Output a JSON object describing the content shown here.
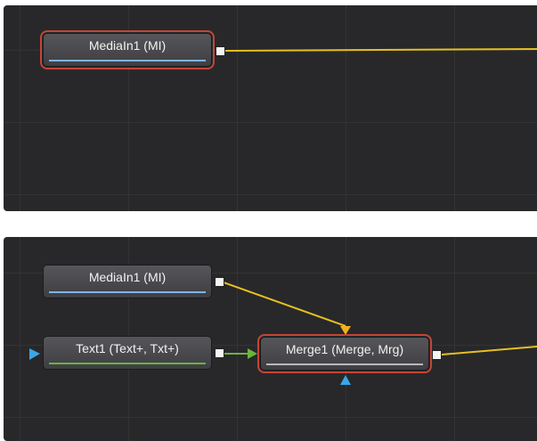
{
  "colors": {
    "panel_bg": "#28282a",
    "grid": "#333336",
    "selection_outline": "#c44535",
    "image_wire": "#e6c020",
    "text_wire": "#6ab43c",
    "foreground_input": "#f0b11e",
    "mask_input": "#3aa6e8"
  },
  "top_panel": {
    "nodes": [
      {
        "id": "mediain1",
        "label": "MediaIn1  (MI)",
        "bar": "blue",
        "selected": true
      }
    ]
  },
  "bottom_panel": {
    "nodes": [
      {
        "id": "mediain1",
        "label": "MediaIn1  (MI)",
        "bar": "blue",
        "selected": false
      },
      {
        "id": "text1",
        "label": "Text1  (Text+, Txt+)",
        "bar": "green",
        "selected": false
      },
      {
        "id": "merge1",
        "label": "Merge1  (Merge, Mrg)",
        "bar": "gray",
        "selected": true
      }
    ]
  },
  "icons": {
    "output_port": "output-port-icon",
    "foreground_input": "triangle-down-icon",
    "mask_input": "triangle-up-icon",
    "text_input": "triangle-right-icon"
  }
}
